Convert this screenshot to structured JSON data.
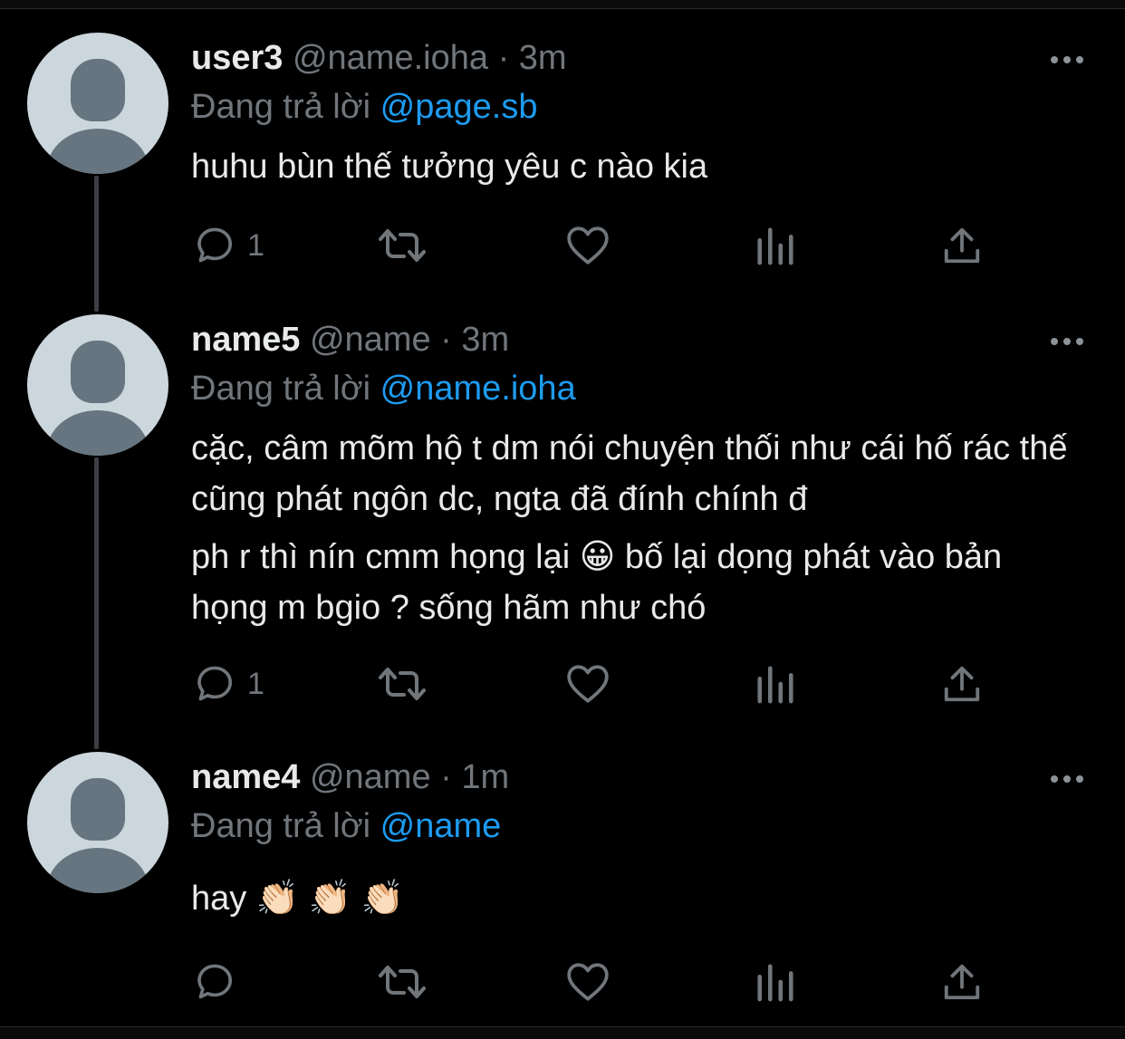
{
  "tweets": [
    {
      "display_name": "user3",
      "handle": "@name.ioha",
      "separator": "·",
      "time": "3m",
      "reply_prefix": "Đang trả lời",
      "reply_to": "@page.sb",
      "body": [
        "huhu bùn thế tưởng yêu c nào kia"
      ],
      "reply_count": "1"
    },
    {
      "display_name": "name5",
      "handle": "@name",
      "separator": "·",
      "time": "3m",
      "reply_prefix": "Đang trả lời",
      "reply_to": "@name.ioha",
      "body": [
        "cặc, câm mõm hộ t dm nói chuyện thối như cái hố rác thế cũng phát ngôn dc, ngta đã đính chính đ",
        "ph r thì nín cmm họng lại 😀 bố lại dọng phát vào bản họng m bgio ? sống hãm như chó"
      ],
      "reply_count": "1"
    },
    {
      "display_name": "name4",
      "handle": "@name",
      "separator": "·",
      "time": "1m",
      "reply_prefix": "Đang trả lời",
      "reply_to": "@name",
      "body": [
        "hay 👏🏻 👏🏻 👏🏻"
      ],
      "reply_count": ""
    }
  ],
  "icons": {
    "reply": "reply-icon",
    "retweet": "retweet-icon",
    "like": "heart-icon",
    "analytics": "analytics-icon",
    "share": "share-icon",
    "more": "more-icon"
  },
  "colors": {
    "background": "#000000",
    "text": "#e7e9ea",
    "muted": "#71767b",
    "mention": "#1d9bf0",
    "thread_line": "#3b3f44",
    "avatar_bg": "#ccd6dd",
    "avatar_fg": "#66757f"
  }
}
